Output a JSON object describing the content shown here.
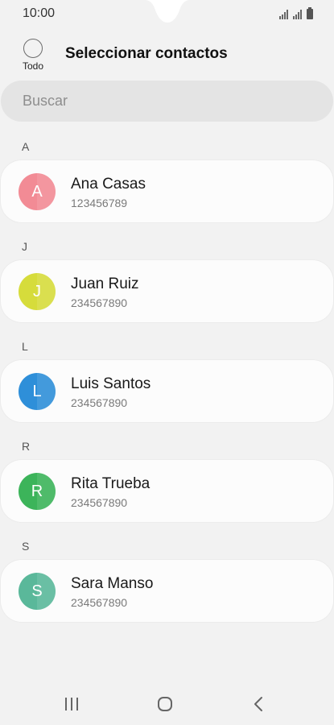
{
  "status_bar": {
    "time": "10:00"
  },
  "header": {
    "select_all_label": "Todo",
    "title": "Seleccionar contactos"
  },
  "search": {
    "placeholder": "Buscar"
  },
  "sections": [
    {
      "letter": "A",
      "contact": {
        "initial": "A",
        "name": "Ana Casas",
        "phone": "123456789",
        "color": "#f28b95"
      }
    },
    {
      "letter": "J",
      "contact": {
        "initial": "J",
        "name": "Juan Ruiz",
        "phone": "234567890",
        "color": "#d6dc3b"
      }
    },
    {
      "letter": "L",
      "contact": {
        "initial": "L",
        "name": "Luis Santos",
        "phone": "234567890",
        "color": "#2e8fd9"
      }
    },
    {
      "letter": "R",
      "contact": {
        "initial": "R",
        "name": "Rita Trueba",
        "phone": "234567890",
        "color": "#3cb45a"
      }
    },
    {
      "letter": "S",
      "contact": {
        "initial": "S",
        "name": "Sara Manso",
        "phone": "234567890",
        "color": "#5ab89a"
      }
    }
  ],
  "nav_bar": {
    "icons": [
      "recents-icon",
      "home-icon",
      "back-icon"
    ]
  }
}
